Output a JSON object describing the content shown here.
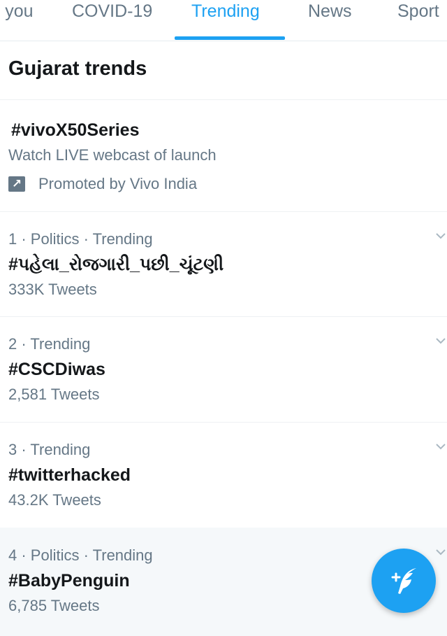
{
  "tabs": [
    {
      "label": "r you",
      "active": false
    },
    {
      "label": "COVID-19",
      "active": false
    },
    {
      "label": "Trending",
      "active": true
    },
    {
      "label": "News",
      "active": false
    },
    {
      "label": "Sport",
      "active": false
    }
  ],
  "section": {
    "title": "Gujarat trends"
  },
  "promoted": {
    "name": "#vivoX50Series",
    "description": "Watch LIVE webcast of launch",
    "promoted_by": "Promoted by Vivo India",
    "icon": "promoted-arrow-icon"
  },
  "trends": [
    {
      "meta": "1 · Politics · Trending",
      "name": "#પહેલા_રોજગારી_પછી_ચૂંટણી",
      "count": "333K Tweets"
    },
    {
      "meta": "2 · Trending",
      "name": "#CSCDiwas",
      "count": "2,581 Tweets"
    },
    {
      "meta": "3 · Trending",
      "name": "#twitterhacked",
      "count": "43.2K Tweets"
    },
    {
      "meta": "4 · Politics · Trending",
      "name": "#BabyPenguin",
      "count": "6,785 Tweets"
    }
  ],
  "fab": {
    "icon": "compose-tweet-icon",
    "label": "+"
  },
  "colors": {
    "accent": "#1da1f2",
    "text": "#14171a",
    "secondary": "#657786"
  }
}
